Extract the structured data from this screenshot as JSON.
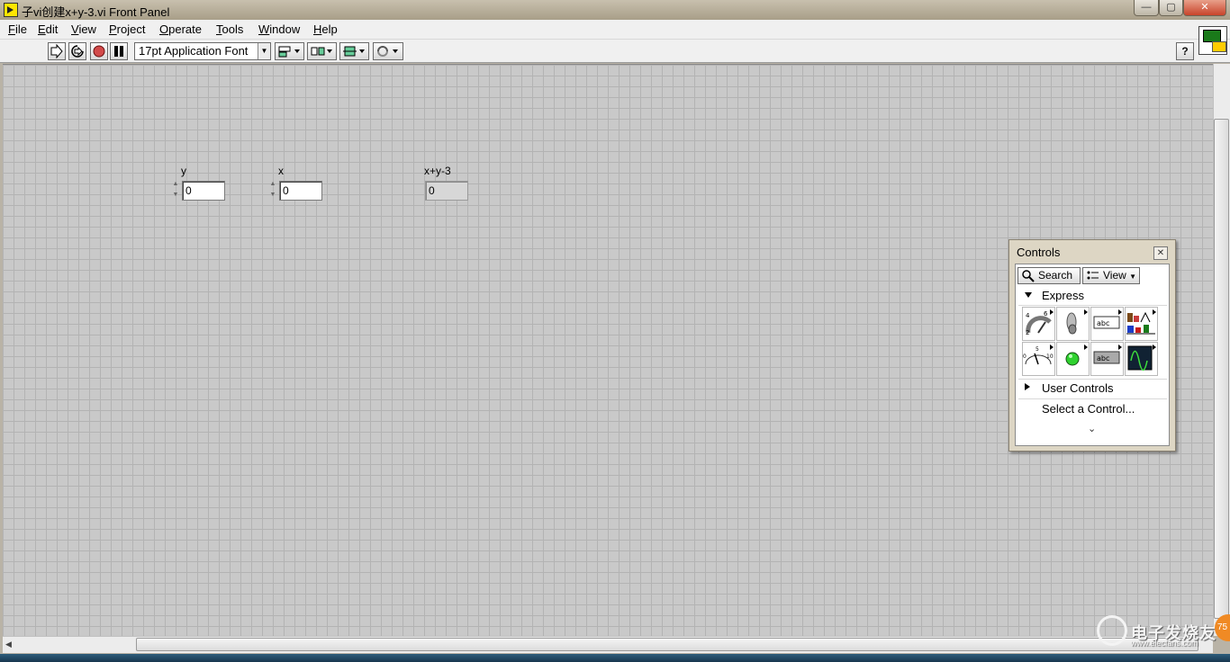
{
  "window": {
    "title": "子vi创建x+y-3.vi Front Panel",
    "controls": [
      "—",
      "▢",
      "✕"
    ]
  },
  "menu": [
    {
      "label": "File"
    },
    {
      "label": "Edit"
    },
    {
      "label": "View"
    },
    {
      "label": "Project"
    },
    {
      "label": "Operate"
    },
    {
      "label": "Tools"
    },
    {
      "label": "Window"
    },
    {
      "label": "Help"
    }
  ],
  "toolbar": {
    "run_icon": "run-arrow-icon",
    "run_continuous_icon": "run-continuously-icon",
    "abort_icon": "abort-icon",
    "pause_icon": "pause-icon",
    "font": "17pt Application Font",
    "align_icon": "align-objects-icon",
    "distribute_icon": "distribute-objects-icon",
    "resize_icon": "resize-objects-icon",
    "reorder_icon": "reorder-icon",
    "help": "?"
  },
  "front_panel": {
    "controls": [
      {
        "label": "y",
        "value": "0",
        "kind": "control"
      },
      {
        "label": "x",
        "value": "0",
        "kind": "control"
      },
      {
        "label": "x+y-3",
        "value": "0",
        "kind": "indicator"
      }
    ]
  },
  "controls_palette": {
    "title": "Controls",
    "search_label": "Search",
    "view_label": "View",
    "express_label": "Express",
    "user_controls_label": "User Controls",
    "select_control_label": "Select a Control...",
    "express_items": [
      "numeric-controls-icon",
      "buttons-switches-icon",
      "text-controls-icon",
      "user-controls-graph-icon",
      "numeric-indicators-icon",
      "led-indicator-icon",
      "text-indicators-icon",
      "graph-indicators-icon"
    ],
    "text_controls_sample": "abc",
    "text_indicators_sample": "abc"
  },
  "watermark": {
    "cn": "电子发烧友",
    "url": "www.elecfans.com",
    "badge": "75"
  }
}
